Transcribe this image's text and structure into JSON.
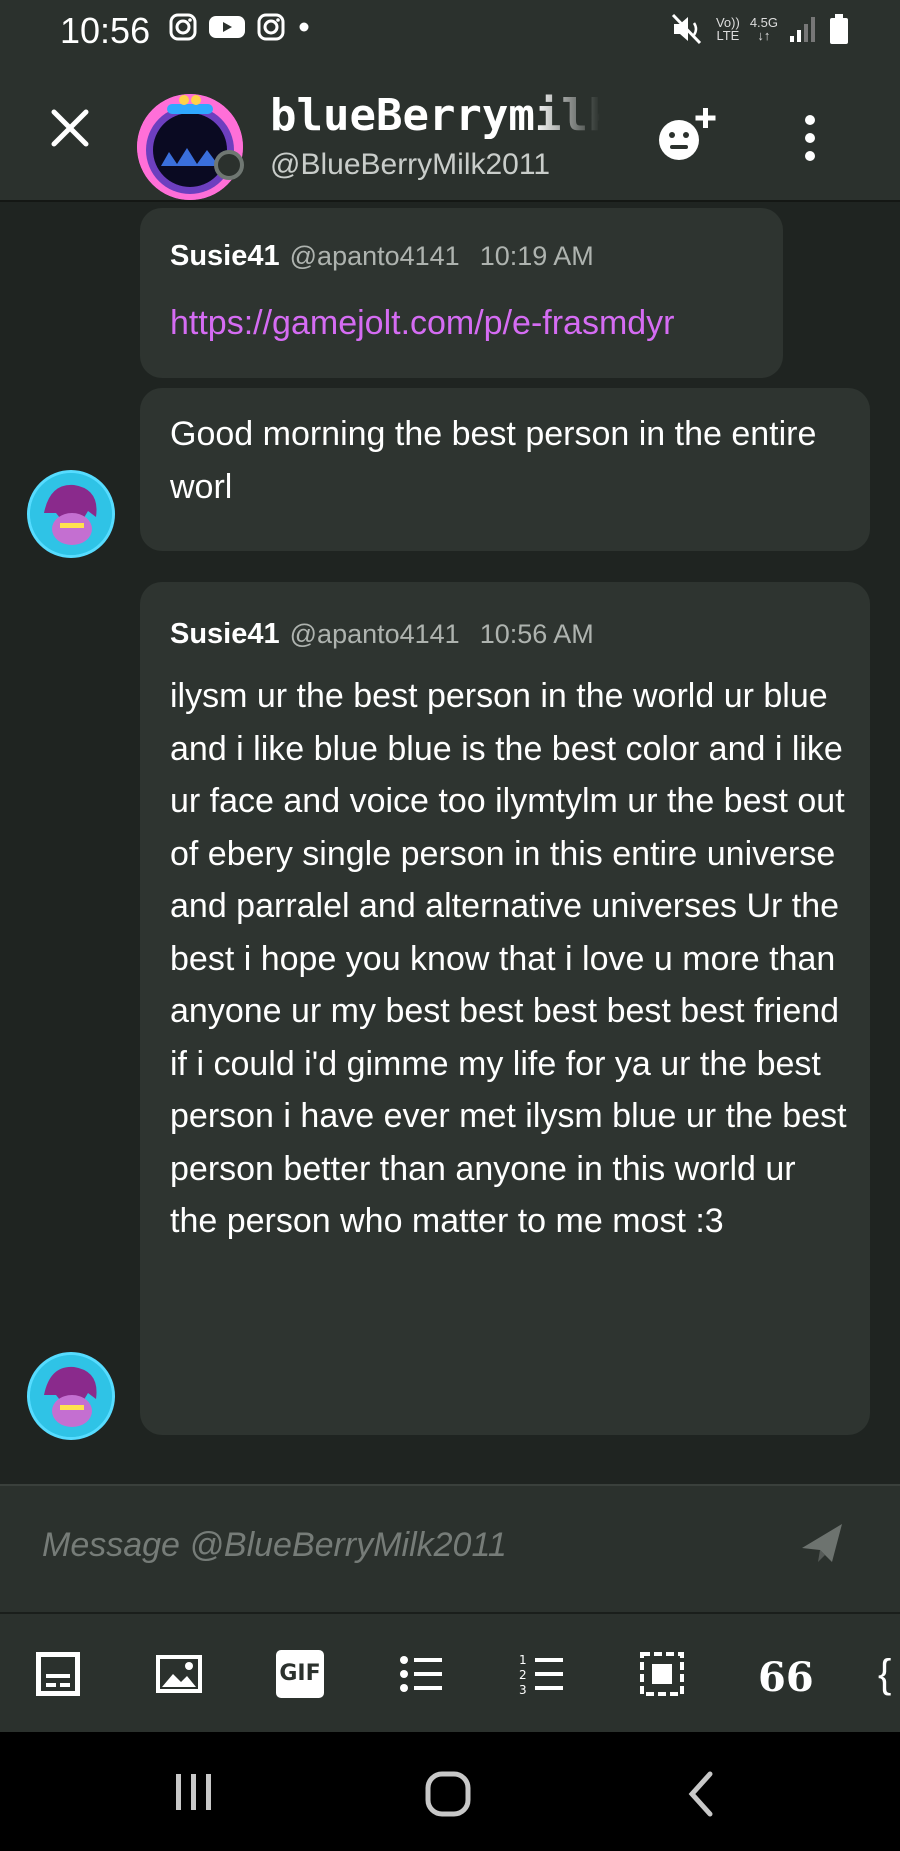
{
  "status_bar": {
    "time": "10:56",
    "volte": "Vo))",
    "lte": "LTE",
    "net": "4.5G"
  },
  "header": {
    "name": "blueBerrymilk",
    "handle": "@BlueBerryMilk2011"
  },
  "messages": [
    {
      "author": "Susie41",
      "handle": "@apanto4141",
      "time": "10:19 AM",
      "link": "https://gamejolt.com/p/e-frasmdyr"
    },
    {
      "text": "Good morning the best person in the entire worl"
    },
    {
      "author": "Susie41",
      "handle": "@apanto4141",
      "time": "10:56 AM",
      "text": "ilysm ur the best person in the world ur blue and i like blue blue is the best color and i like ur face and voice too ilymtylm ur the best out of ebery single person in this entire universe and parralel and alternative universes Ur the best i hope you know that i love u more than anyone ur my best best best best best friend if i could i'd gimme my life for ya ur the best person i have ever met ilysm blue ur the best person better than anyone in this world ur the person who matter to me most :3"
    }
  ],
  "composer": {
    "placeholder": "Message @BlueBerryMilk2011"
  },
  "toolbar": {
    "gif_label": "GIF",
    "quote_label": "66",
    "code_label": "{"
  },
  "colors": {
    "background": "#1f2421",
    "bar": "#2b312d",
    "bubble": "#2e3430",
    "link": "#d56cf3"
  }
}
